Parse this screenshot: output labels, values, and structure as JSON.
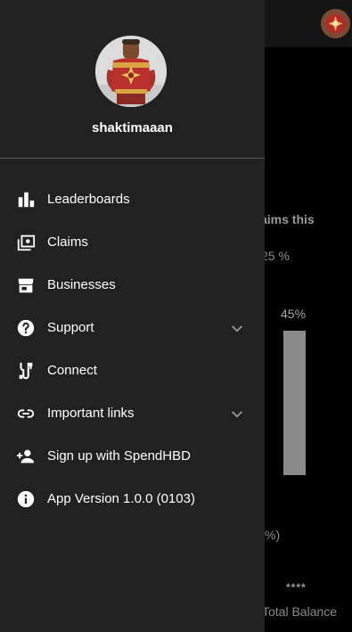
{
  "background": {
    "claims_title": "aims this",
    "percent_25": "25 %",
    "percent_45": "45%",
    "percent_close": "%)",
    "balance_masked": "****",
    "total_balance_label": "Total Balance"
  },
  "drawer": {
    "username": "shaktimaaan",
    "menu": [
      {
        "label": "Leaderboards",
        "icon": "bar-chart-icon"
      },
      {
        "label": "Claims",
        "icon": "claims-icon"
      },
      {
        "label": "Businesses",
        "icon": "storefront-icon"
      },
      {
        "label": "Support",
        "icon": "help-circle-icon",
        "expandable": true
      },
      {
        "label": "Connect",
        "icon": "connect-icon"
      },
      {
        "label": "Important links",
        "icon": "link-icon",
        "expandable": true
      },
      {
        "label": "Sign up with SpendHBD",
        "icon": "person-add-icon"
      },
      {
        "label": "App Version 1.0.0 (0103)",
        "icon": "info-icon"
      }
    ]
  },
  "colors": {
    "drawer_bg": "#212121",
    "screen_bg": "#000000",
    "text_primary": "#ffffff",
    "divider": "#5a5a5a"
  }
}
